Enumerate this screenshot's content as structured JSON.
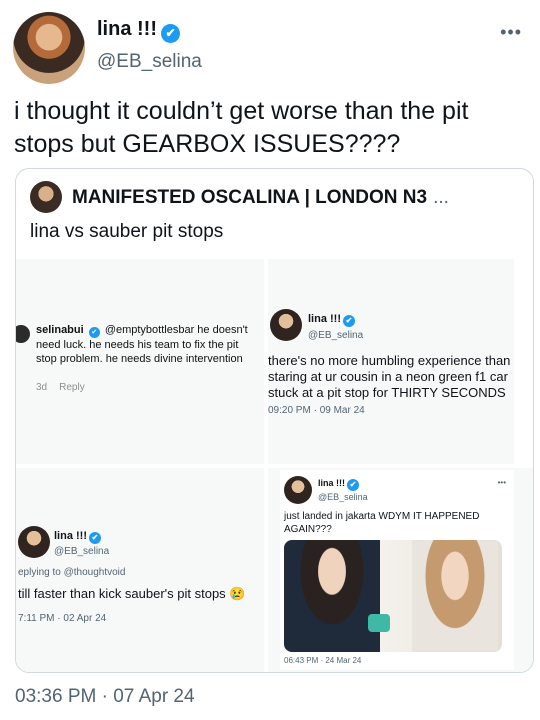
{
  "tweet": {
    "author_name": "lina !!!",
    "author_handle": "@EB_selina",
    "more_label": "•••",
    "text": "i thought it couldn’t get worse than the pit stops but GEARBOX ISSUES????",
    "timestamp": "03:36 PM · 07 Apr 24"
  },
  "quote": {
    "author_name": "MANIFESTED OSCALINA | LONDON N3",
    "ellipsis": "...",
    "text": "lina vs sauber pit stops",
    "panels": {
      "instagram_comment": {
        "username": "selinabui",
        "mention": "@emptybottlesbar",
        "body": " he doesn't need luck. he needs his team to fix the pit stop problem. he needs divine intervention",
        "age": "3d",
        "reply_label": "Reply"
      },
      "tweet_top_right": {
        "name": "lina !!!",
        "handle": "@EB_selina",
        "text": "there's no more humbling experience than staring at ur cousin in a neon green f1 car stuck at a pit stop for THIRTY SECONDS",
        "time": "09:20 PM · 09 Mar 24"
      },
      "tweet_bottom_left": {
        "name": "lina !!!",
        "handle": "@EB_selina",
        "replying": "eplying to @thoughtvoid",
        "text": "till faster than kick sauber's pit stops 😢",
        "time": "7:11 PM · 02 Apr 24"
      },
      "tweet_bottom_right": {
        "name": "lina !!!",
        "handle": "@EB_selina",
        "more_label": "•••",
        "text": "just landed in jakarta WDYM IT HAPPENED AGAIN???",
        "time": "06:43 PM · 24 Mar 24"
      }
    }
  },
  "icons": {
    "verified": "✔"
  },
  "colors": {
    "accent": "#1d9bf0",
    "muted": "#536471"
  }
}
